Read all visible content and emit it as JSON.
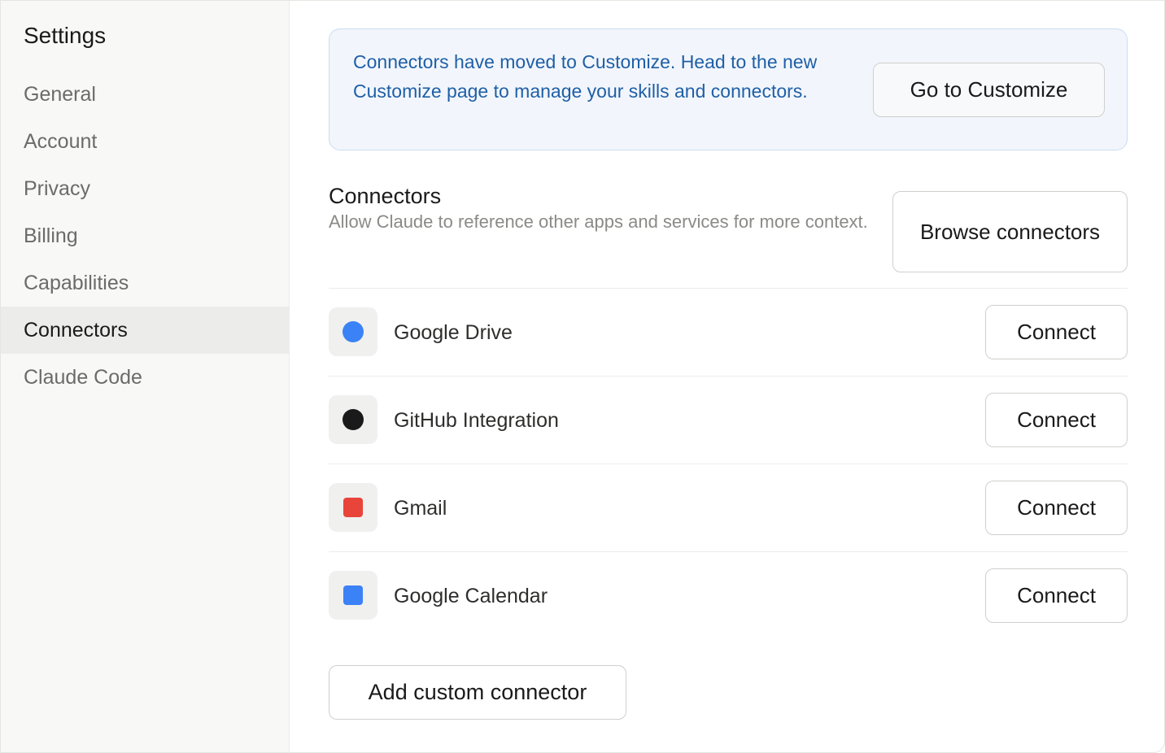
{
  "sidebar": {
    "title": "Settings",
    "items": [
      {
        "label": "General",
        "active": false
      },
      {
        "label": "Account",
        "active": false
      },
      {
        "label": "Privacy",
        "active": false
      },
      {
        "label": "Billing",
        "active": false
      },
      {
        "label": "Capabilities",
        "active": false
      },
      {
        "label": "Connectors",
        "active": true
      },
      {
        "label": "Claude Code",
        "active": false
      }
    ]
  },
  "banner": {
    "text": "Connectors have moved to Customize. Head to the new Customize page to manage your skills and connectors.",
    "button_label": "Go to Customize"
  },
  "connectors_section": {
    "title": "Connectors",
    "description": "Allow Claude to reference other apps and services for more context.",
    "browse_button_label": "Browse connectors"
  },
  "connectors": [
    {
      "name": "Google Drive",
      "icon": "google-drive-icon",
      "icon_color": "#3b82f6",
      "icon_shape": "circle",
      "button_label": "Connect"
    },
    {
      "name": "GitHub Integration",
      "icon": "github-icon",
      "icon_color": "#1a1a1a",
      "icon_shape": "circle",
      "button_label": "Connect"
    },
    {
      "name": "Gmail",
      "icon": "gmail-icon",
      "icon_color": "#e8443a",
      "icon_shape": "square",
      "button_label": "Connect"
    },
    {
      "name": "Google Calendar",
      "icon": "google-calendar-icon",
      "icon_color": "#3b82f6",
      "icon_shape": "square",
      "button_label": "Connect"
    }
  ],
  "add_custom_label": "Add custom connector"
}
